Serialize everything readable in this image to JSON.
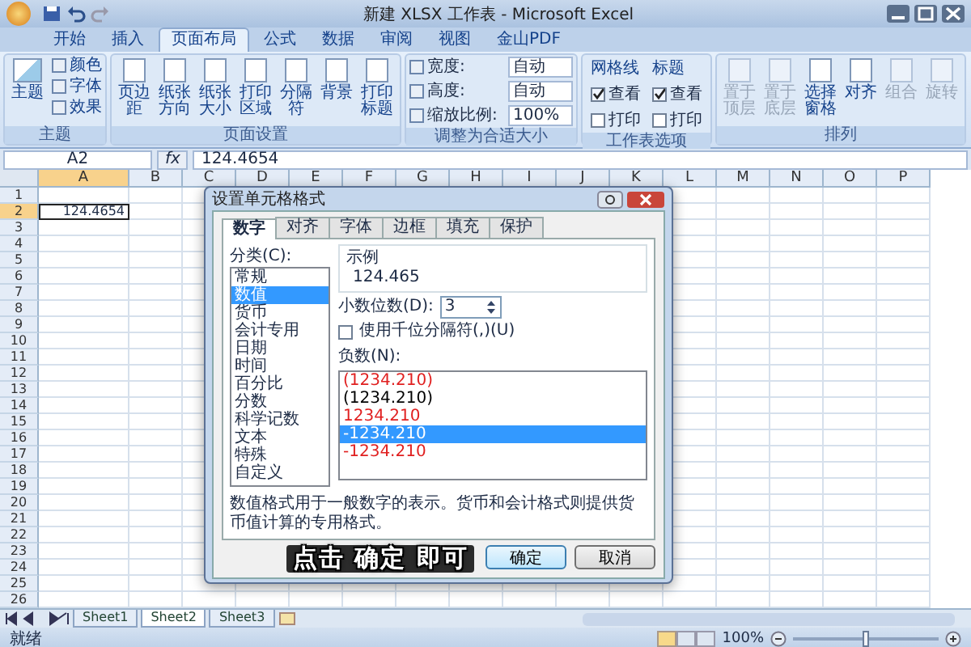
{
  "window": {
    "title": "新建 XLSX 工作表 - Microsoft Excel"
  },
  "ribbon_tabs": [
    {
      "label": "开始",
      "selected": false
    },
    {
      "label": "插入",
      "selected": false
    },
    {
      "label": "页面布局",
      "selected": true
    },
    {
      "label": "公式",
      "selected": false
    },
    {
      "label": "数据",
      "selected": false
    },
    {
      "label": "审阅",
      "selected": false
    },
    {
      "label": "视图",
      "selected": false
    },
    {
      "label": "金山PDF",
      "selected": false
    }
  ],
  "ribbon_groups": [
    {
      "kind": "theme",
      "label": "主题",
      "big": "主题",
      "small": [
        "颜色",
        "字体",
        "效果"
      ]
    },
    {
      "kind": "buttons",
      "label": "页面设置",
      "buttons": [
        {
          "label": "页边距",
          "disabled": false
        },
        {
          "label": "纸张方向",
          "disabled": false
        },
        {
          "label": "纸张大小",
          "disabled": false
        },
        {
          "label": "打印区域",
          "disabled": false
        },
        {
          "label": "分隔符",
          "disabled": false
        },
        {
          "label": "背景",
          "disabled": false
        },
        {
          "label": "打印标题",
          "disabled": false
        }
      ]
    },
    {
      "kind": "fit",
      "label": "调整为合适大小",
      "fields": [
        {
          "label": "宽度:",
          "value": "自动"
        },
        {
          "label": "高度:",
          "value": "自动"
        },
        {
          "label": "缩放比例:",
          "value": "100%"
        }
      ]
    },
    {
      "kind": "options",
      "label": "工作表选项",
      "columns": [
        {
          "title": "网格线",
          "options": [
            {
              "label": "查看",
              "checked": true
            },
            {
              "label": "打印",
              "checked": false
            }
          ]
        },
        {
          "title": "标题",
          "options": [
            {
              "label": "查看",
              "checked": true
            },
            {
              "label": "打印",
              "checked": false
            }
          ]
        }
      ]
    },
    {
      "kind": "buttons",
      "label": "排列",
      "buttons": [
        {
          "label": "置于顶层",
          "disabled": true
        },
        {
          "label": "置于底层",
          "disabled": true
        },
        {
          "label": "选择窗格",
          "disabled": false
        },
        {
          "label": "对齐",
          "disabled": false
        },
        {
          "label": "组合",
          "disabled": true
        },
        {
          "label": "旋转",
          "disabled": true
        }
      ]
    }
  ],
  "formula_bar": {
    "name_box": "A2",
    "fx": "fx",
    "value": "124.4654"
  },
  "grid": {
    "columns": [
      {
        "label": "A",
        "selected": true
      },
      {
        "label": "B",
        "selected": false
      },
      {
        "label": "C",
        "selected": false
      },
      {
        "label": "D",
        "selected": false
      },
      {
        "label": "E",
        "selected": false
      },
      {
        "label": "F",
        "selected": false
      },
      {
        "label": "G",
        "selected": false
      },
      {
        "label": "H",
        "selected": false
      },
      {
        "label": "I",
        "selected": false
      },
      {
        "label": "J",
        "selected": false
      },
      {
        "label": "K",
        "selected": false
      },
      {
        "label": "L",
        "selected": false
      },
      {
        "label": "M",
        "selected": false
      },
      {
        "label": "N",
        "selected": false
      },
      {
        "label": "O",
        "selected": false
      },
      {
        "label": "P",
        "selected": false
      }
    ],
    "rows": [
      {
        "label": "1",
        "selected": false
      },
      {
        "label": "2",
        "selected": true,
        "cell_a": "124.4654"
      },
      {
        "label": "3",
        "selected": false
      },
      {
        "label": "4",
        "selected": false
      },
      {
        "label": "5",
        "selected": false
      },
      {
        "label": "6",
        "selected": false
      },
      {
        "label": "7",
        "selected": false
      },
      {
        "label": "8",
        "selected": false
      },
      {
        "label": "9",
        "selected": false
      },
      {
        "label": "10",
        "selected": false
      },
      {
        "label": "11",
        "selected": false
      },
      {
        "label": "12",
        "selected": false
      },
      {
        "label": "13",
        "selected": false
      },
      {
        "label": "14",
        "selected": false
      },
      {
        "label": "15",
        "selected": false
      },
      {
        "label": "16",
        "selected": false
      },
      {
        "label": "17",
        "selected": false
      },
      {
        "label": "18",
        "selected": false
      },
      {
        "label": "19",
        "selected": false
      },
      {
        "label": "20",
        "selected": false
      },
      {
        "label": "21",
        "selected": false
      },
      {
        "label": "22",
        "selected": false
      },
      {
        "label": "23",
        "selected": false
      },
      {
        "label": "24",
        "selected": false
      },
      {
        "label": "25",
        "selected": false
      },
      {
        "label": "26",
        "selected": false
      }
    ]
  },
  "dialog": {
    "title": "设置单元格格式",
    "tabs": [
      {
        "label": "数字",
        "selected": true
      },
      {
        "label": "对齐",
        "selected": false
      },
      {
        "label": "字体",
        "selected": false
      },
      {
        "label": "边框",
        "selected": false
      },
      {
        "label": "填充",
        "selected": false
      },
      {
        "label": "保护",
        "selected": false
      }
    ],
    "category_label": "分类(C):",
    "categories": [
      {
        "label": "常规",
        "selected": false
      },
      {
        "label": "数值",
        "selected": true
      },
      {
        "label": "货币",
        "selected": false
      },
      {
        "label": "会计专用",
        "selected": false
      },
      {
        "label": "日期",
        "selected": false
      },
      {
        "label": "时间",
        "selected": false
      },
      {
        "label": "百分比",
        "selected": false
      },
      {
        "label": "分数",
        "selected": false
      },
      {
        "label": "科学记数",
        "selected": false
      },
      {
        "label": "文本",
        "selected": false
      },
      {
        "label": "特殊",
        "selected": false
      },
      {
        "label": "自定义",
        "selected": false
      }
    ],
    "sample_label": "示例",
    "sample_value": "124.465",
    "decimals_label": "小数位数(D):",
    "decimals_value": "3",
    "thousands": {
      "label": "使用千位分隔符(,)(U)",
      "checked": false
    },
    "negative_label": "负数(N):",
    "negatives": [
      {
        "text": "(1234.210)",
        "color": "#e02020",
        "selected": false
      },
      {
        "text": "(1234.210)",
        "color": "#000000",
        "selected": false
      },
      {
        "text": "1234.210",
        "color": "#e02020",
        "selected": false
      },
      {
        "text": "-1234.210",
        "selected": true
      },
      {
        "text": "-1234.210",
        "color": "#e02020",
        "selected": false
      }
    ],
    "description": "数值格式用于一般数字的表示。货币和会计格式则提供货币值计算的专用格式。",
    "buttons": [
      "确定",
      "取消"
    ]
  },
  "sheet_tabs": [
    {
      "label": "Sheet1",
      "selected": false
    },
    {
      "label": "Sheet2",
      "selected": true
    },
    {
      "label": "Sheet3",
      "selected": false
    }
  ],
  "status_bar": {
    "status": "就绪",
    "zoom": "100%",
    "zoom_slider": {
      "level": 0.5
    }
  },
  "caption": "点击 确定 即可"
}
